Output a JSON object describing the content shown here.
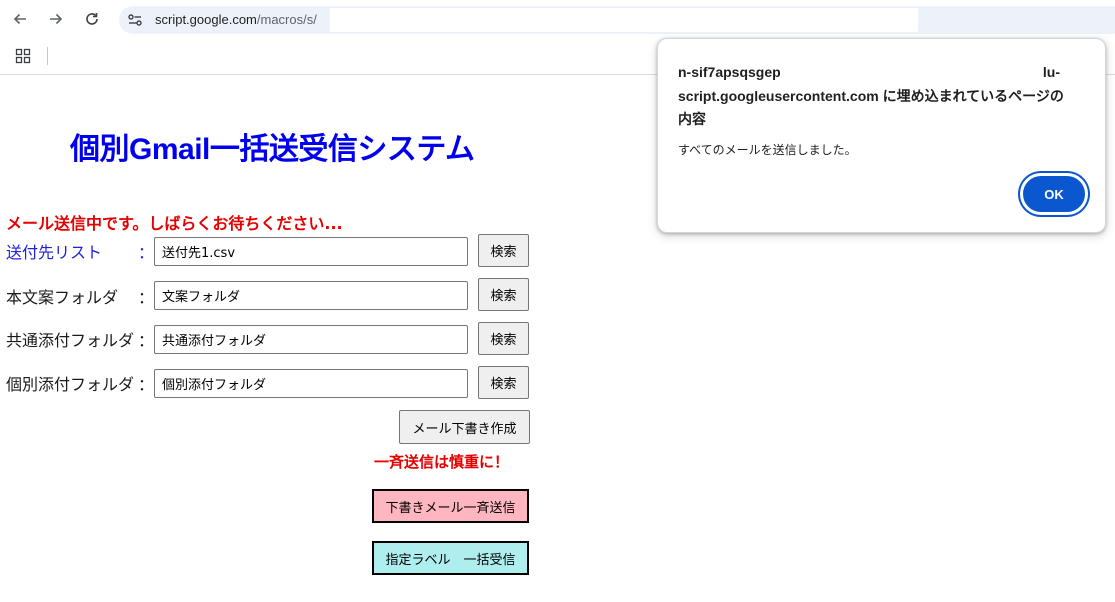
{
  "browser": {
    "url_domain": "script.google.com",
    "url_path": "/macros/s/"
  },
  "page": {
    "title": "個別Gmail一括送受信システム",
    "status_message": "メール送信中です。しばらくお待ちください...",
    "fields": [
      {
        "label": "送付先リスト",
        "colon": "：",
        "value": "送付先1.csv",
        "button": "検索"
      },
      {
        "label": "本文案フォルダ",
        "colon": "：",
        "value": "文案フォルダ",
        "button": "検索"
      },
      {
        "label": "共通添付フォルダ",
        "colon": "：",
        "value": "共通添付フォルダ",
        "button": "検索"
      },
      {
        "label": "個別添付フォルダ",
        "colon": "：",
        "value": "個別添付フォルダ",
        "button": "検索"
      }
    ],
    "draft_button": "メール下書き作成",
    "warning": "一斉送信は慎重に！",
    "send_button": "下書きメール一斉送信",
    "receive_button": "指定ラベル　一括受信"
  },
  "dialog": {
    "origin_part1": "n-sif7apsqsgep",
    "origin_part2": "lu-",
    "origin_line2": "script.googleusercontent.com に埋め込まれているページの",
    "origin_line3": "内容",
    "message": "すべてのメールを送信しました。",
    "ok_label": "OK"
  },
  "colors": {
    "title": "#0000ee",
    "alert_text": "#e60000",
    "send_button_bg": "#ffb6c1",
    "receive_button_bg": "#afeeee",
    "ok_button_bg": "#0b57d0"
  }
}
